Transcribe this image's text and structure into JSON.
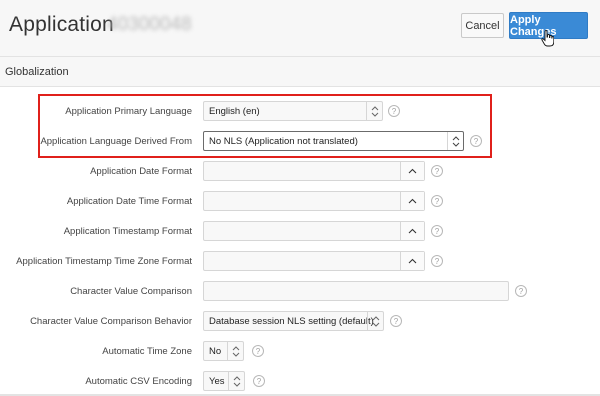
{
  "header": {
    "title": "Application",
    "app_id": "40300048",
    "cancel_label": "Cancel",
    "apply_label": "Apply Changes"
  },
  "region": {
    "title": "Globalization"
  },
  "fields": {
    "primary_language": {
      "label": "Application Primary Language",
      "value": "English (en)"
    },
    "language_derived_from": {
      "label": "Application Language Derived From",
      "value": "No NLS (Application not translated)"
    },
    "date_format": {
      "label": "Application Date Format",
      "value": ""
    },
    "date_time_format": {
      "label": "Application Date Time Format",
      "value": ""
    },
    "timestamp_format": {
      "label": "Application Timestamp Format",
      "value": ""
    },
    "timestamp_tz_format": {
      "label": "Application Timestamp Time Zone Format",
      "value": ""
    },
    "char_value_comparison": {
      "label": "Character Value Comparison",
      "value": ""
    },
    "char_value_comparison_behavior": {
      "label": "Character Value Comparison Behavior",
      "value": "Database session NLS setting (default)"
    },
    "automatic_time_zone": {
      "label": "Automatic Time Zone",
      "value": "No"
    },
    "automatic_csv_encoding": {
      "label": "Automatic CSV Encoding",
      "value": "Yes"
    }
  },
  "help_glyph": "?",
  "colors": {
    "accent": "#3a8ad6",
    "highlight": "#e0201b"
  }
}
